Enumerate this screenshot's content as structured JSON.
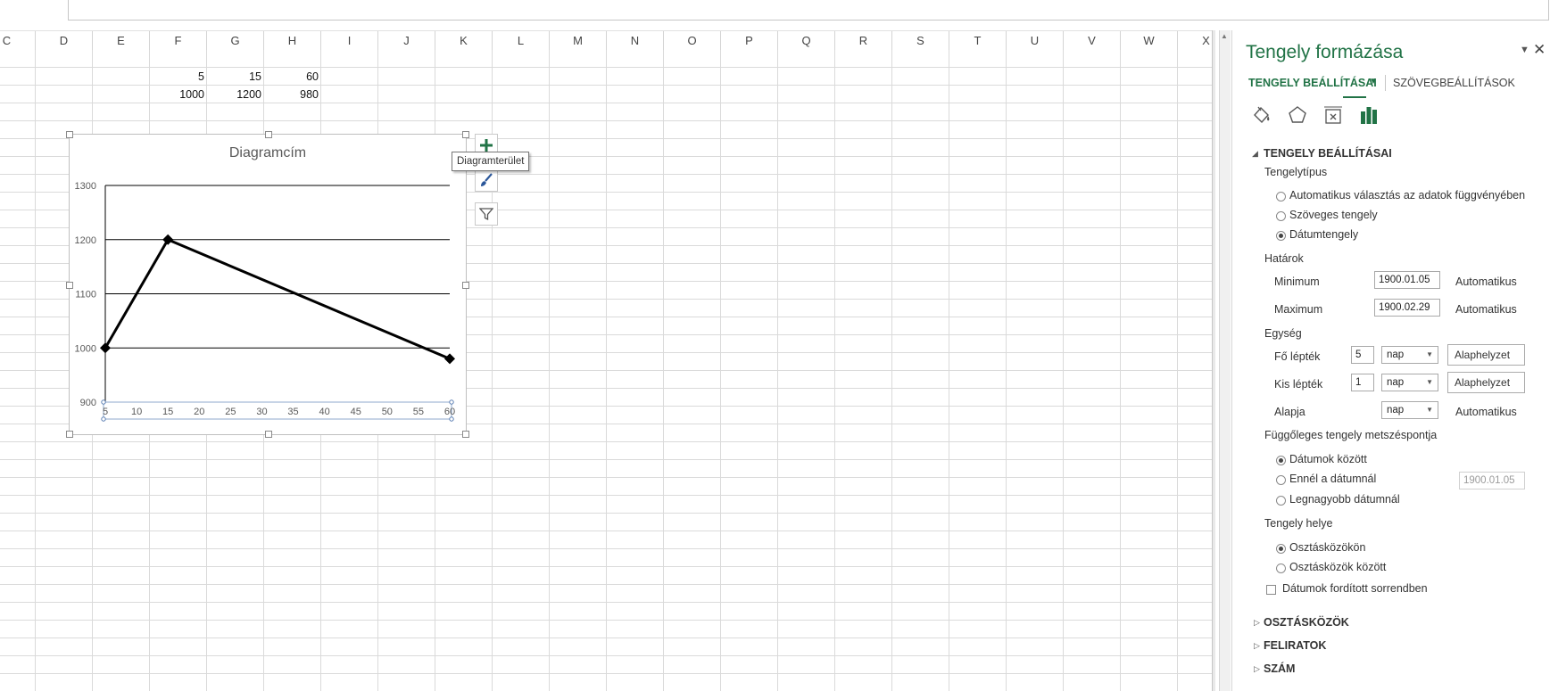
{
  "spreadsheet": {
    "columns": [
      "C",
      "D",
      "E",
      "F",
      "G",
      "H",
      "I",
      "J",
      "K",
      "L",
      "M",
      "N",
      "O",
      "P",
      "Q",
      "R",
      "S",
      "T",
      "U",
      "V",
      "W",
      "X"
    ],
    "cells": {
      "F1": "5",
      "G1": "15",
      "H1": "60",
      "F2": "1000",
      "G2": "1200",
      "H2": "980"
    }
  },
  "chart_data": {
    "type": "line",
    "title": "Diagramcím",
    "x": [
      5,
      15,
      60
    ],
    "series": [
      {
        "values": [
          1000,
          1200,
          980
        ]
      }
    ],
    "x_ticks": [
      "5",
      "10",
      "15",
      "20",
      "25",
      "30",
      "35",
      "40",
      "45",
      "50",
      "55",
      "60"
    ],
    "y_ticks": [
      "900",
      "1000",
      "1100",
      "1200",
      "1300"
    ],
    "xlim": [
      5,
      60
    ],
    "ylim": [
      900,
      1300
    ],
    "grid": "horizontal",
    "marker": "diamond",
    "line_color": "#000000"
  },
  "chart_tools": {
    "tooltip": "Diagramterület",
    "icons": [
      "plus-icon",
      "brush-icon",
      "filter-icon"
    ]
  },
  "pane": {
    "title": "Tengely formázása",
    "tab_axis": "TENGELY BEÁLLÍTÁSAI",
    "tab_text": "SZÖVEGBEÁLLÍTÁSOK",
    "icons": [
      "fill-bucket-icon",
      "pentagon-icon",
      "size-properties-icon",
      "bar-chart-icon"
    ],
    "accent_color": "#217346",
    "section_axis_options": "TENGELY BEÁLLÍTÁSAI",
    "axis_type_label": "Tengelytípus",
    "axis_type_options": [
      "Automatikus választás az adatok függvényében",
      "Szöveges tengely",
      "Dátumtengely"
    ],
    "bounds_label": "Határok",
    "min_label": "Minimum",
    "min_value": "1900.01.05",
    "min_auto": "Automatikus",
    "max_label": "Maximum",
    "max_value": "1900.02.29",
    "max_auto": "Automatikus",
    "units_label": "Egység",
    "major_label": "Fő lépték",
    "major_value": "5",
    "major_unit": "nap",
    "major_reset": "Alaphelyzet",
    "minor_label": "Kis lépték",
    "minor_value": "1",
    "minor_unit": "nap",
    "minor_reset": "Alaphelyzet",
    "base_label": "Alapja",
    "base_unit": "nap",
    "base_auto": "Automatikus",
    "vertical_cross_label": "Függőleges tengely metszéspontja",
    "cross_options": [
      "Dátumok között",
      "Ennél a dátumnál",
      "Legnagyobb dátumnál"
    ],
    "cross_date_value": "1900.01.05",
    "axis_position_label": "Tengely helye",
    "position_options": [
      "Osztásközökön",
      "Osztásközök között"
    ],
    "reverse_label": "Dátumok fordított sorrendben",
    "collapsed_sections": [
      "OSZTÁSKÖZÖK",
      "FELIRATOK",
      "SZÁM"
    ]
  }
}
